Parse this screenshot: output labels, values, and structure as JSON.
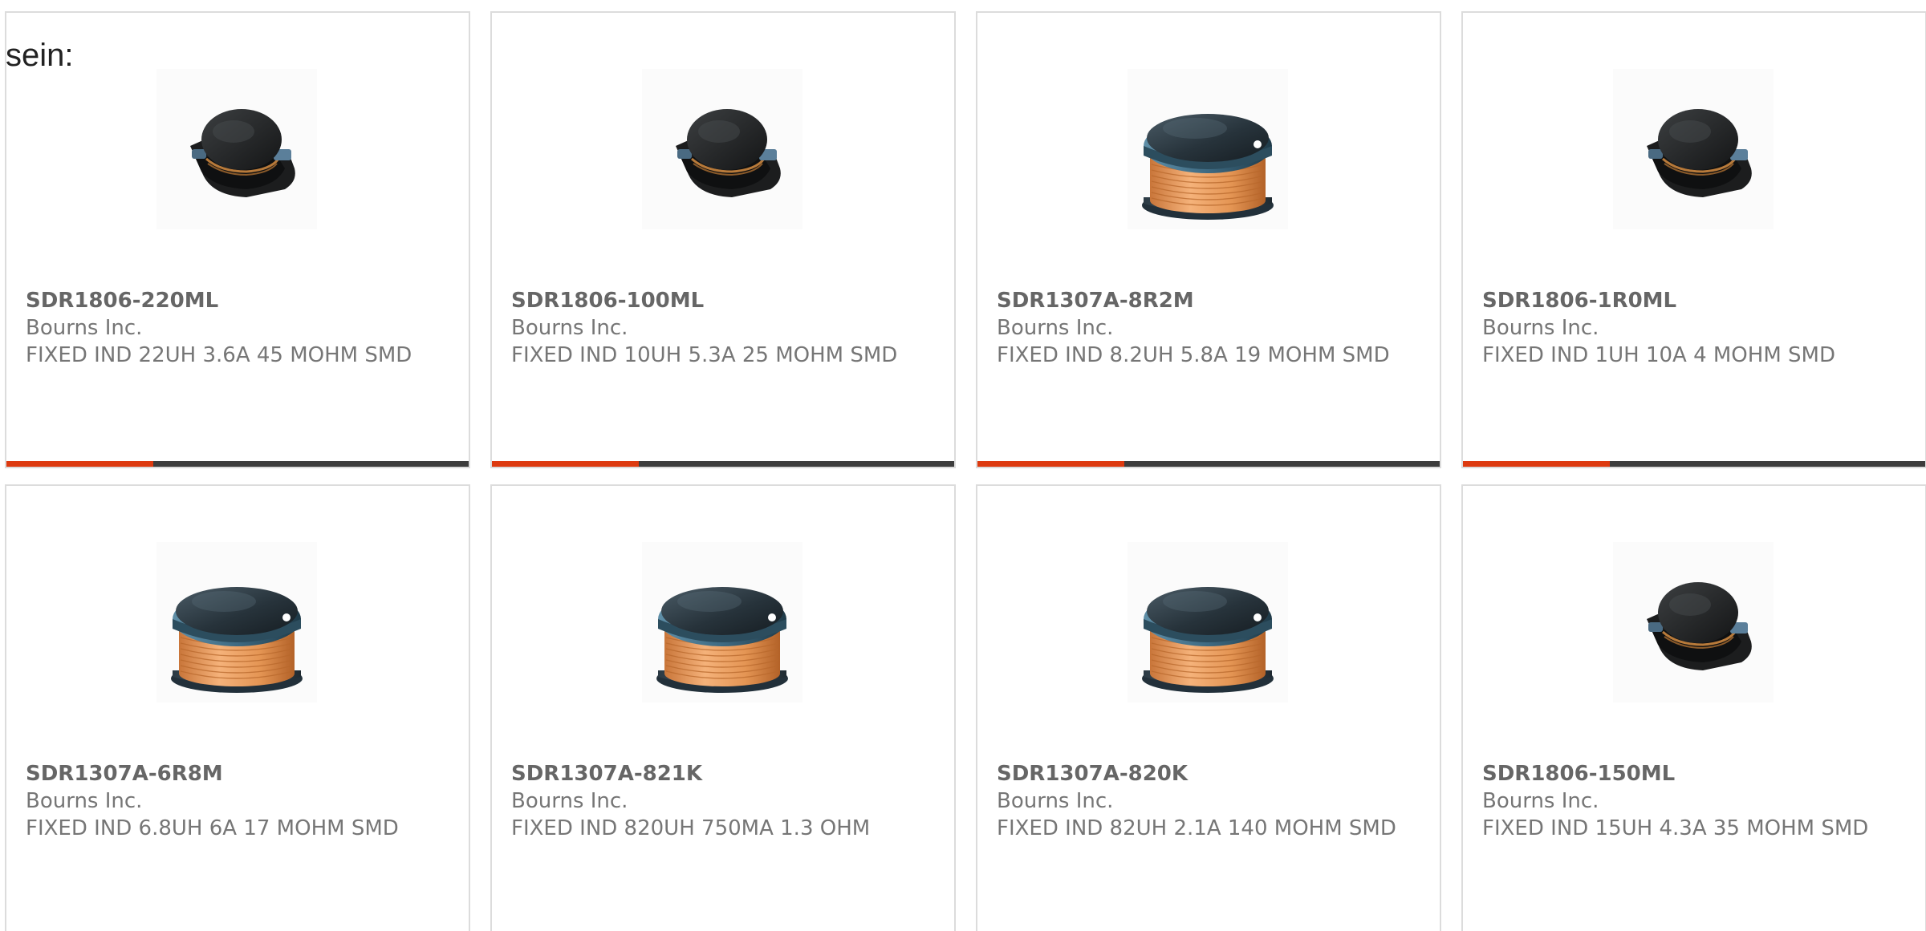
{
  "intro_text": "sein:",
  "colors": {
    "card_border": "#dcdcdc",
    "bar_dark": "#3d3d3d",
    "bar_accent": "#dd3a10",
    "title_text": "#666666",
    "body_text": "#767676"
  },
  "products": [
    {
      "part_number": "SDR1806-220ML",
      "manufacturer": "Bourns Inc.",
      "description": "FIXED IND 22UH 3.6A 45 MOHM SMD",
      "image": "small-shielded-smd-inductor-icon"
    },
    {
      "part_number": "SDR1806-100ML",
      "manufacturer": "Bourns Inc.",
      "description": "FIXED IND 10UH 5.3A 25 MOHM SMD",
      "image": "small-shielded-smd-inductor-icon"
    },
    {
      "part_number": "SDR1307A-8R2M",
      "manufacturer": "Bourns Inc.",
      "description": "FIXED IND 8.2UH 5.8A 19 MOHM SMD",
      "image": "copper-wound-smd-inductor-icon"
    },
    {
      "part_number": "SDR1806-1R0ML",
      "manufacturer": "Bourns Inc.",
      "description": "FIXED IND 1UH 10A 4 MOHM SMD",
      "image": "small-shielded-smd-inductor-icon"
    },
    {
      "part_number": "SDR1307A-6R8M",
      "manufacturer": "Bourns Inc.",
      "description": "FIXED IND 6.8UH 6A 17 MOHM SMD",
      "image": "copper-wound-smd-inductor-icon"
    },
    {
      "part_number": "SDR1307A-821K",
      "manufacturer": "Bourns Inc.",
      "description": "FIXED IND 820UH 750MA 1.3 OHM",
      "image": "copper-wound-smd-inductor-icon"
    },
    {
      "part_number": "SDR1307A-820K",
      "manufacturer": "Bourns Inc.",
      "description": "FIXED IND 82UH 2.1A 140 MOHM SMD",
      "image": "copper-wound-smd-inductor-icon"
    },
    {
      "part_number": "SDR1806-150ML",
      "manufacturer": "Bourns Inc.",
      "description": "FIXED IND 15UH 4.3A 35 MOHM SMD",
      "image": "small-shielded-smd-inductor-icon"
    }
  ]
}
